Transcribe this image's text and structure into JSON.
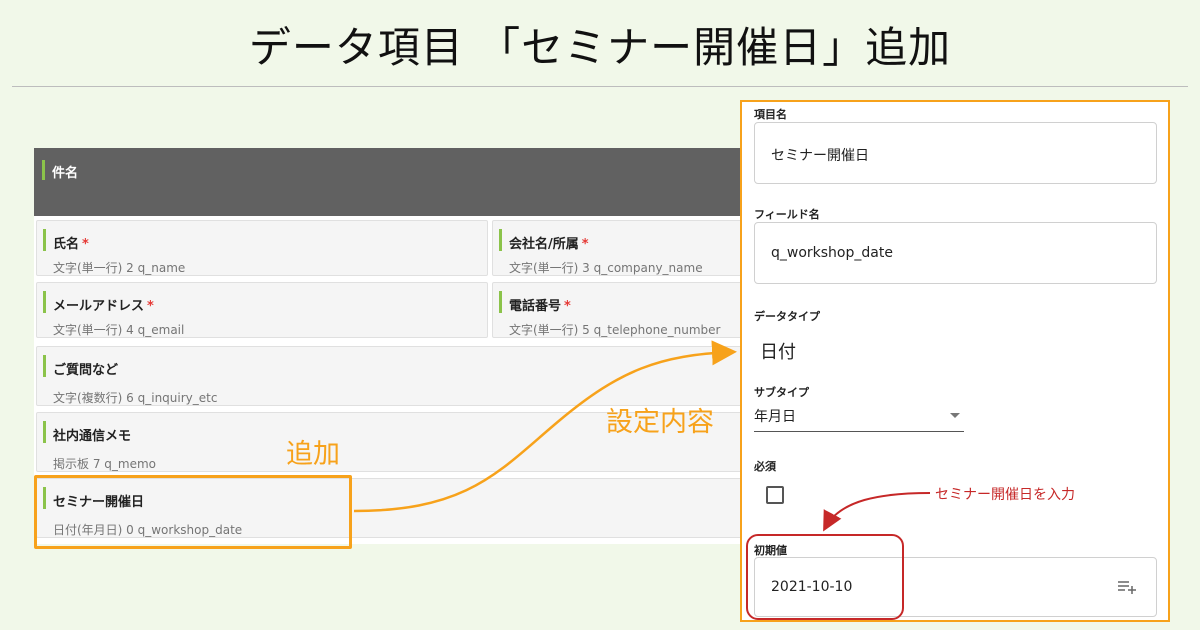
{
  "page": {
    "title": "データ項目 「セミナー開催日」追加"
  },
  "form": {
    "section_header": "件名",
    "fields": [
      {
        "label": "氏名",
        "required": "*",
        "meta": "文字(単一行) 2 q_name"
      },
      {
        "label": "会社名/所属",
        "required": "*",
        "meta": "文字(単一行) 3 q_company_name"
      },
      {
        "label": "メールアドレス",
        "required": "*",
        "meta": "文字(単一行) 4 q_email"
      },
      {
        "label": "電話番号",
        "required": "*",
        "meta": "文字(単一行) 5 q_telephone_number"
      },
      {
        "label": "ご質問など",
        "meta": "文字(複数行) 6 q_inquiry_etc"
      },
      {
        "label": "社内通信メモ",
        "meta": "掲示板 7 q_memo"
      },
      {
        "label": "セミナー開催日",
        "meta": "日付(年月日) 0 q_workshop_date"
      }
    ]
  },
  "callouts": {
    "added": "追加",
    "settings": "設定内容",
    "enter_seminar_date": "セミナー開催日を入力"
  },
  "settings": {
    "item_name_label": "項目名",
    "item_name_value": "セミナー開催日",
    "field_name_label": "フィールド名",
    "field_name_value": "q_workshop_date",
    "data_type_label": "データタイプ",
    "data_type_value": "日付",
    "subtype_label": "サブタイプ",
    "subtype_value": "年月日",
    "required_label": "必須",
    "required_checked": false,
    "initial_value_label": "初期値",
    "initial_value": "2021-10-10",
    "icons": {
      "subtype_caret": "chevron-down-icon",
      "initial_value_action": "list-add-icon"
    }
  },
  "colors": {
    "background": "#f1f8e9",
    "header_bar": "#616161",
    "field_accent": "#8bc34a",
    "highlight_orange": "#f7a21b",
    "highlight_red": "#c62828",
    "required_star": "#e53935"
  }
}
